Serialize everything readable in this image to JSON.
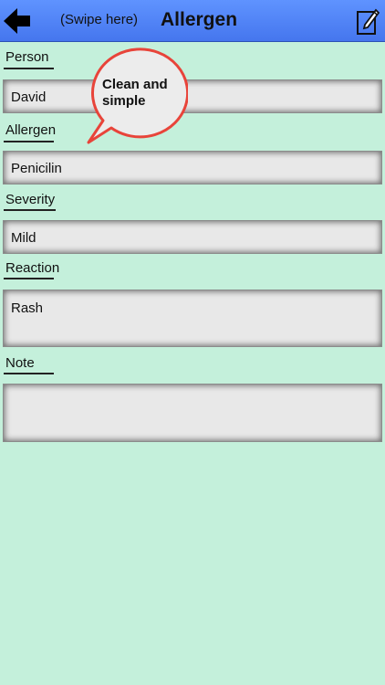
{
  "header": {
    "swipe_hint": "(Swipe here)",
    "title": "Allergen",
    "back_icon": "back-arrow-icon",
    "edit_icon": "edit-note-icon",
    "bar_color": "#4f81f7"
  },
  "fields": {
    "person": {
      "label": "Person",
      "value": "David"
    },
    "allergen": {
      "label": "Allergen",
      "value": "Penicilin"
    },
    "severity": {
      "label": "Severity",
      "value": "Mild"
    },
    "reaction": {
      "label": "Reaction",
      "value": "Rash"
    },
    "note": {
      "label": "Note",
      "value": ""
    }
  },
  "callout": {
    "text_line1": "Clean and",
    "text_line2": "simple",
    "border_color": "#e8443a"
  },
  "background_color": "#c4f0db"
}
